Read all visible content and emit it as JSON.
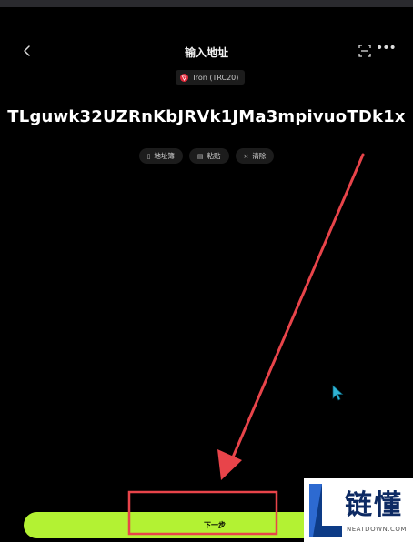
{
  "header": {
    "title": "输入地址"
  },
  "network": {
    "label": "Tron (TRC20)"
  },
  "address": {
    "value": "TLguwk32UZRnKbJRVk1JMa3mpivuoTDk1x"
  },
  "actions": [
    {
      "label": "地址簿",
      "icon": "book-icon"
    },
    {
      "label": "粘贴",
      "icon": "paste-icon"
    },
    {
      "label": "清除",
      "icon": "clear-icon"
    }
  ],
  "footer": {
    "next_label": "下一步"
  },
  "watermark": {
    "text": "链懂",
    "sub": "NEATDOWN.COM"
  },
  "colors": {
    "accent": "#b3f233",
    "annotation": "#e8444a",
    "tron": "#e0293a"
  }
}
